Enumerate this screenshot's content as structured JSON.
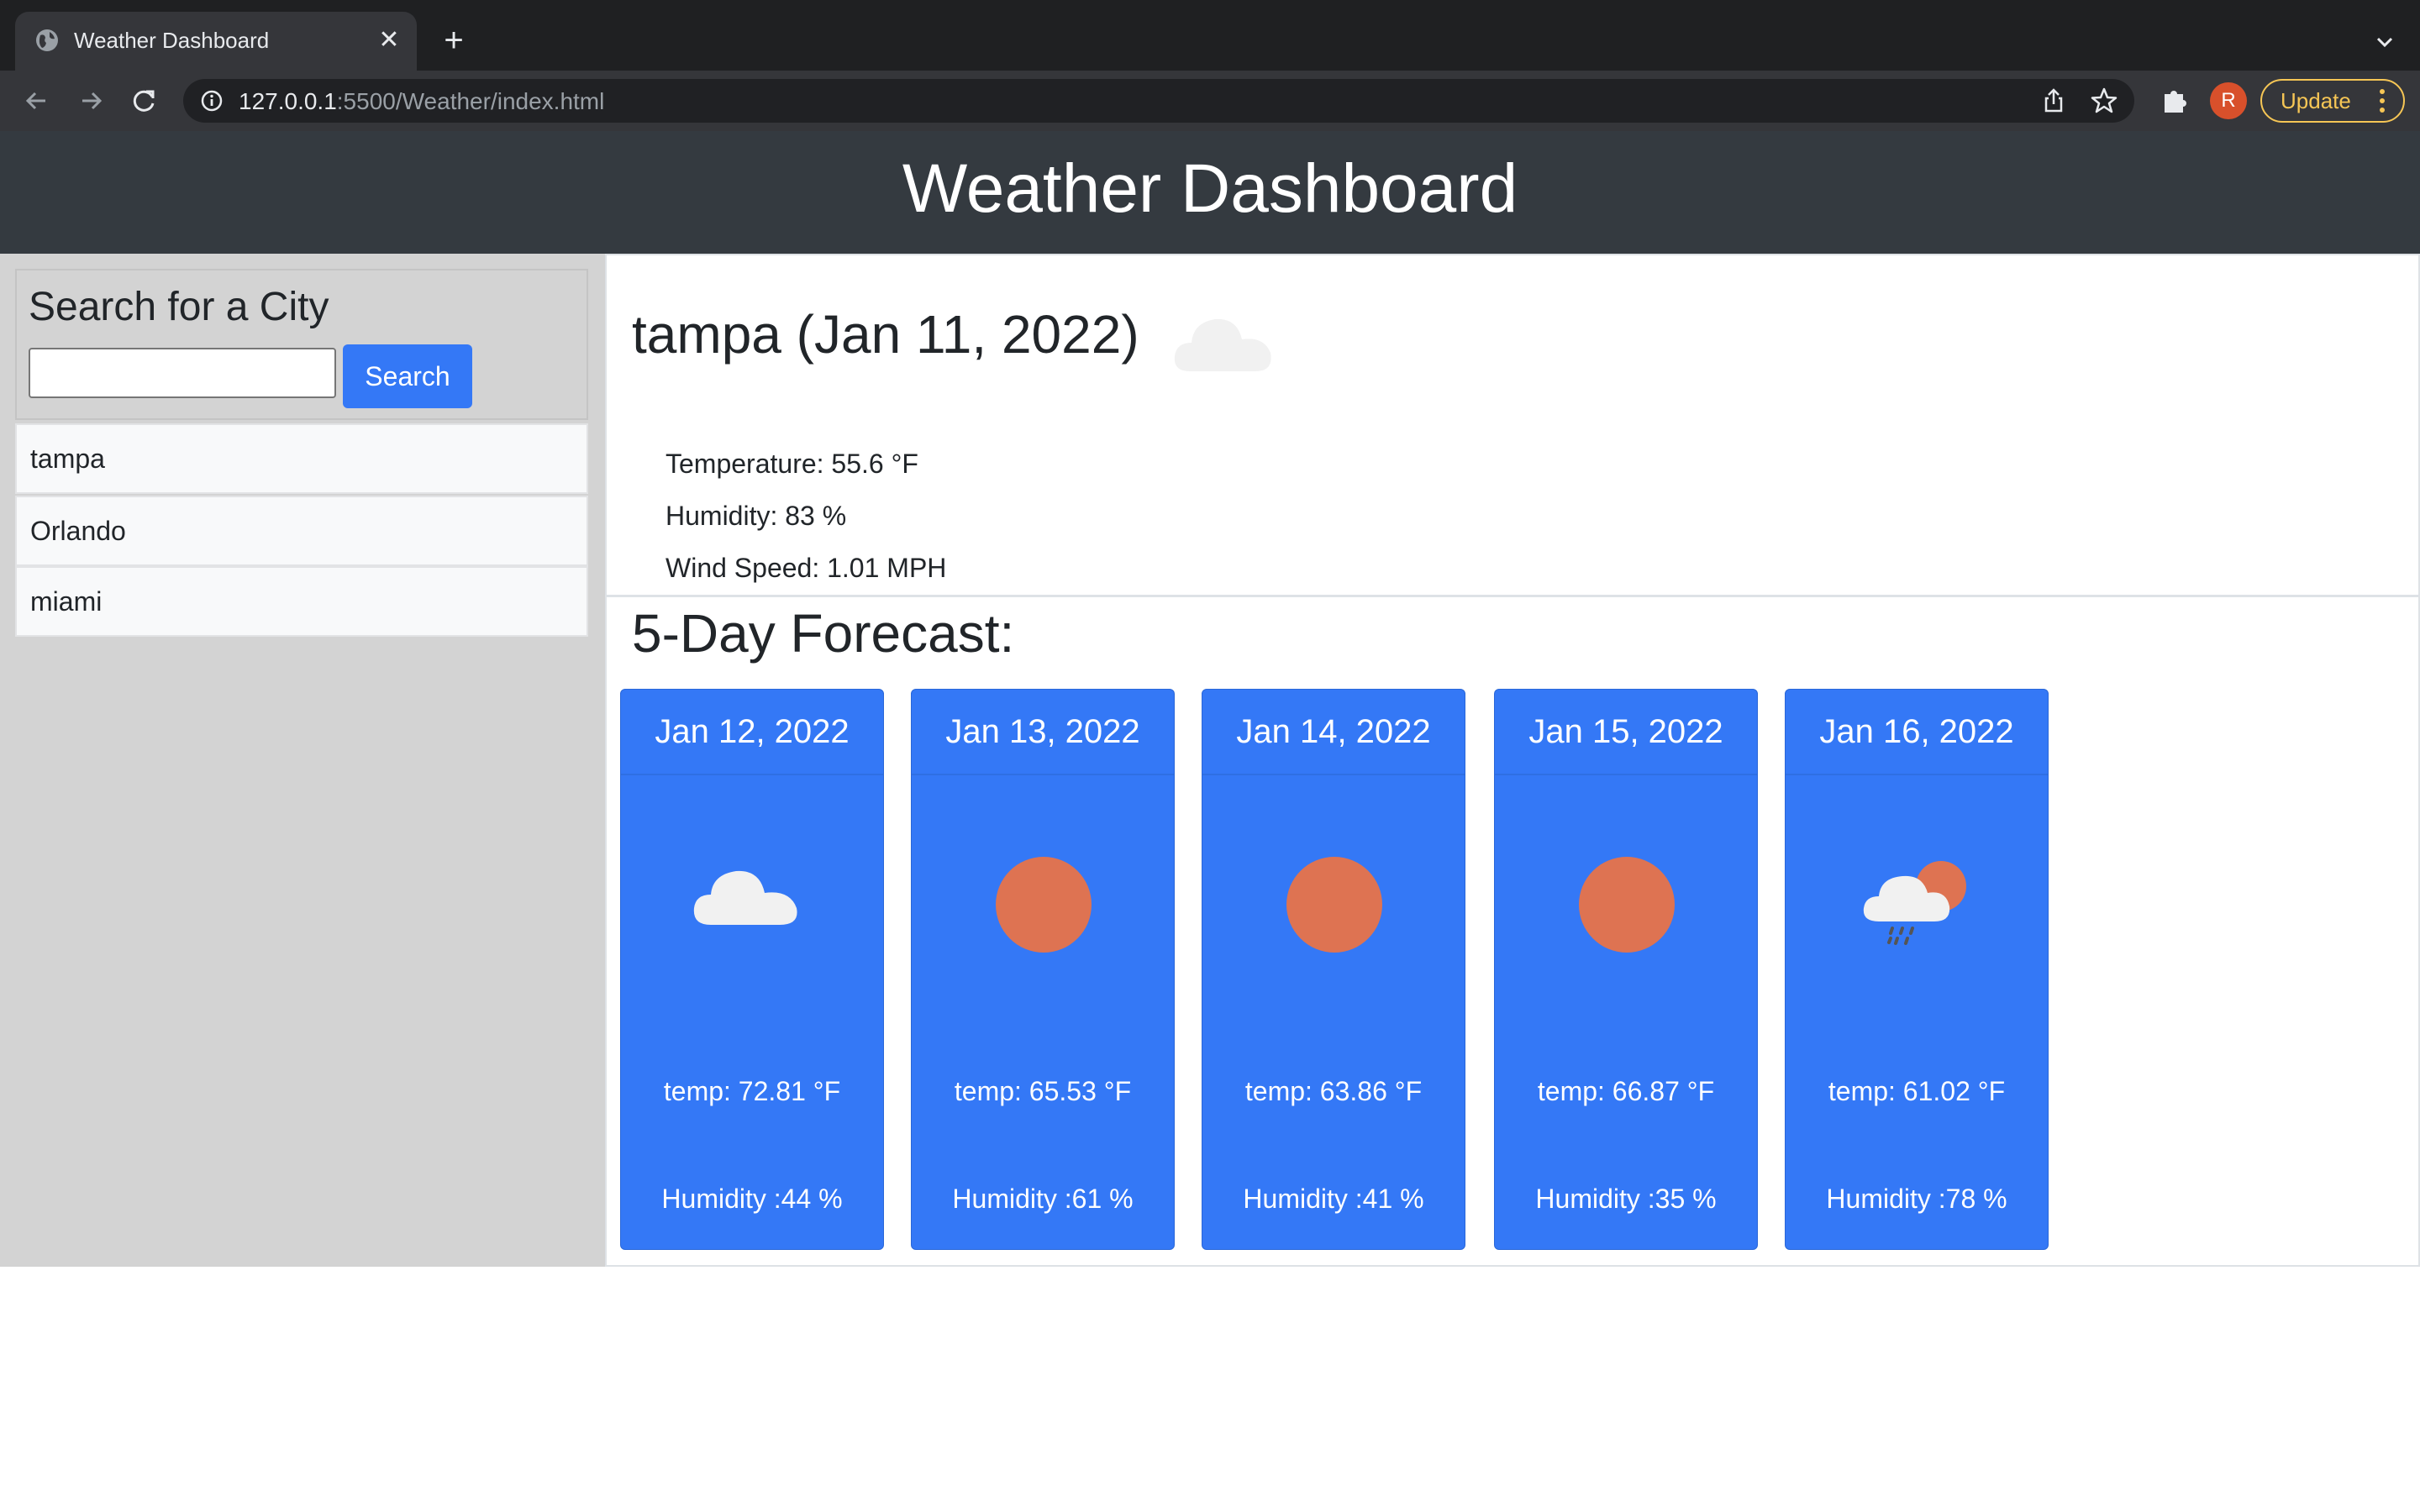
{
  "browser": {
    "tab_title": "Weather Dashboard",
    "url_host": "127.0.0.1",
    "url_rest": ":5500/Weather/index.html",
    "avatar_letter": "R",
    "update_label": "Update"
  },
  "page": {
    "title": "Weather Dashboard"
  },
  "sidebar": {
    "heading": "Search for a City",
    "search_input_value": "",
    "search_button_label": "Search",
    "cities": [
      "tampa",
      "Orlando",
      "miami"
    ]
  },
  "current": {
    "title": "tampa (Jan 11, 2022)",
    "icon": "cloud-icon",
    "temperature": "Temperature: 55.6 °F",
    "humidity": "Humidity: 83 %",
    "wind": "Wind Speed: 1.01 MPH"
  },
  "forecast": {
    "title": "5-Day Forecast:",
    "days": [
      {
        "date": "Jan 12, 2022",
        "icon": "cloud-icon",
        "temp": "temp: 72.81 °F",
        "humidity": "Humidity :44 %"
      },
      {
        "date": "Jan 13, 2022",
        "icon": "sun-icon",
        "temp": "temp: 65.53 °F",
        "humidity": "Humidity :61 %"
      },
      {
        "date": "Jan 14, 2022",
        "icon": "sun-icon",
        "temp": "temp: 63.86 °F",
        "humidity": "Humidity :41 %"
      },
      {
        "date": "Jan 15, 2022",
        "icon": "sun-icon",
        "temp": "temp: 66.87 °F",
        "humidity": "Humidity :35 %"
      },
      {
        "date": "Jan 16, 2022",
        "icon": "rain-sun-icon",
        "temp": "temp: 61.02 °F",
        "humidity": "Humidity :78 %"
      }
    ]
  },
  "colors": {
    "header_bg": "#343a40",
    "sidebar_bg": "#d3d3d3",
    "accent_blue": "#3478f6",
    "sun": "#de7352",
    "cloud": "#f1f1f1"
  }
}
